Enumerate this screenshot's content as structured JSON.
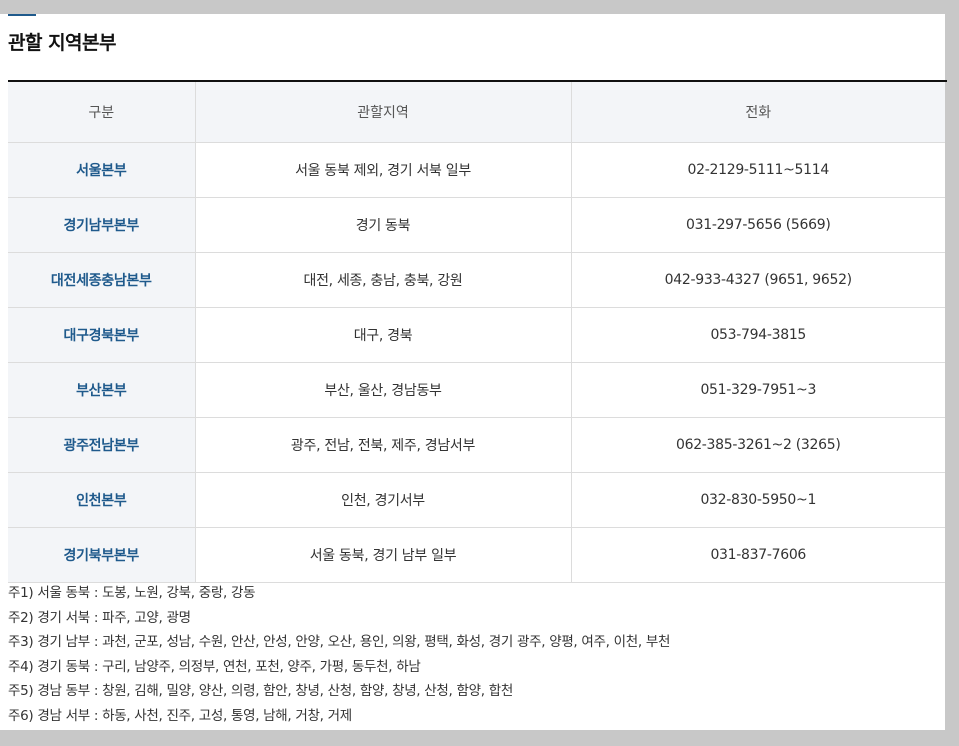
{
  "title": "관할 지역본부",
  "table": {
    "headers": [
      "구분",
      "관할지역",
      "전화"
    ],
    "rows": [
      {
        "name": "서울본부",
        "region": "서울 동북 제외, 경기 서북 일부",
        "phone": "02-2129-5111~5114"
      },
      {
        "name": "경기남부본부",
        "region": "경기 동북",
        "phone": "031-297-5656 (5669)"
      },
      {
        "name": "대전세종충남본부",
        "region": "대전, 세종, 충남, 충북, 강원",
        "phone": "042-933-4327 (9651, 9652)"
      },
      {
        "name": "대구경북본부",
        "region": "대구, 경북",
        "phone": "053-794-3815"
      },
      {
        "name": "부산본부",
        "region": "부산, 울산, 경남동부",
        "phone": "051-329-7951~3"
      },
      {
        "name": "광주전남본부",
        "region": "광주, 전남, 전북, 제주, 경남서부",
        "phone": "062-385-3261~2 (3265)"
      },
      {
        "name": "인천본부",
        "region": "인천, 경기서부",
        "phone": "032-830-5950~1"
      },
      {
        "name": "경기북부본부",
        "region": "서울 동북, 경기 남부 일부",
        "phone": "031-837-7606"
      }
    ]
  },
  "notes": [
    "주1) 서울 동북 : 도봉, 노원, 강북, 중랑, 강동",
    "주2) 경기 서북 : 파주, 고양, 광명",
    "주3) 경기 남부 : 과천, 군포, 성남, 수원, 안산, 안성, 안양, 오산, 용인, 의왕, 평택, 화성, 경기 광주, 양평, 여주, 이천, 부천",
    "주4) 경기 동북 : 구리, 남양주, 의정부, 연천, 포천, 양주, 가평, 동두천, 하남",
    "주5) 경남 동부 : 창원, 김해, 밀양, 양산, 의령, 함안, 창녕, 산청, 함양, 창녕, 산청, 함양, 합천",
    "주6) 경남 서부 : 하동, 사천, 진주, 고성, 통영, 남해, 거창, 거제"
  ],
  "colors": {
    "accent": "#1f5a8c",
    "header_bg": "#f3f5f8",
    "backdrop": "#c8c8c8"
  }
}
